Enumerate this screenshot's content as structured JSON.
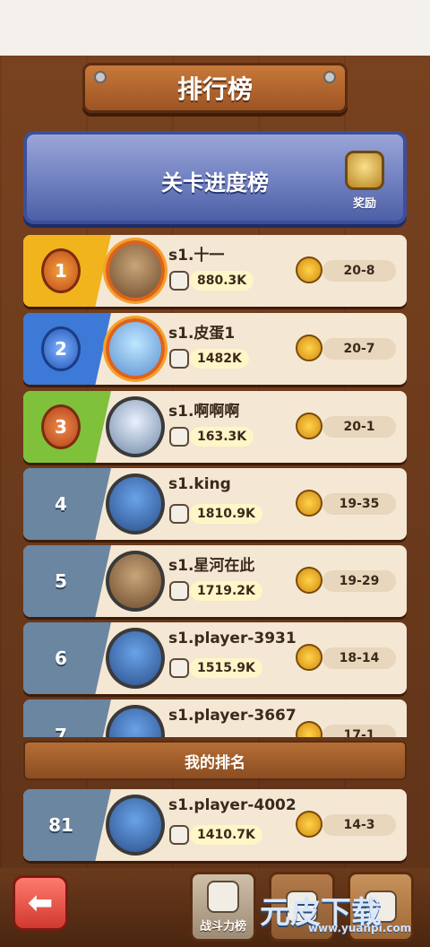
{
  "title": "排行榜",
  "banner": {
    "title": "关卡进度榜",
    "reward_label": "奖励"
  },
  "rows": [
    {
      "rank": "1",
      "name": "s1.十一",
      "power": "880.3K",
      "stage": "20-8",
      "medal": "gold"
    },
    {
      "rank": "2",
      "name": "s1.皮蛋1",
      "power": "1482K",
      "stage": "20-7",
      "medal": "silver"
    },
    {
      "rank": "3",
      "name": "s1.啊啊啊",
      "power": "163.3K",
      "stage": "20-1",
      "medal": "bronze"
    },
    {
      "rank": "4",
      "name": "s1.king",
      "power": "1810.9K",
      "stage": "19-35"
    },
    {
      "rank": "5",
      "name": "s1.星河在此",
      "power": "1719.2K",
      "stage": "19-29"
    },
    {
      "rank": "6",
      "name": "s1.player-3931",
      "power": "1515.9K",
      "stage": "18-14"
    },
    {
      "rank": "7",
      "name": "s1.player-3667",
      "power": "",
      "stage": "17-1"
    }
  ],
  "my_rank": {
    "header": "我的排名",
    "rank": "81",
    "name": "s1.player-4002",
    "power": "1410.7K",
    "stage": "14-3"
  },
  "bottom": {
    "tab_power_label": "战斗力榜",
    "watermark": "元皮下载",
    "watermark_url": "www.yuanpi.com"
  }
}
